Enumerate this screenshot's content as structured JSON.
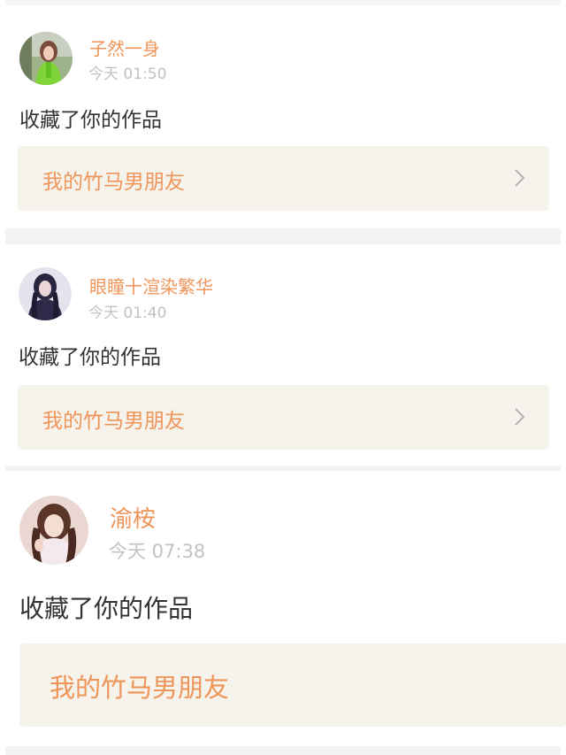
{
  "colors": {
    "accent": "#f0955a",
    "time_gray": "#c2c2c2",
    "text_dark": "#333333",
    "work_box_bg": "#f5f3eb",
    "separator": "#f3f3f3"
  },
  "notifications": [
    {
      "username": "子然一身",
      "time": "今天 01:50",
      "action": "收藏了你的作品",
      "work_title": "我的竹马男朋友",
      "chevron_icon": "chevron-right-icon",
      "avatar_icon": "user-avatar"
    },
    {
      "username": "眼瞳十渲染繁华",
      "time": "今天 01:40",
      "action": "收藏了你的作品",
      "work_title": "我的竹马男朋友",
      "chevron_icon": "chevron-right-icon",
      "avatar_icon": "user-avatar"
    },
    {
      "username": "渝桉",
      "time": "今天 07:38",
      "action": "收藏了你的作品",
      "work_title": "我的竹马男朋友",
      "avatar_icon": "user-avatar"
    }
  ]
}
